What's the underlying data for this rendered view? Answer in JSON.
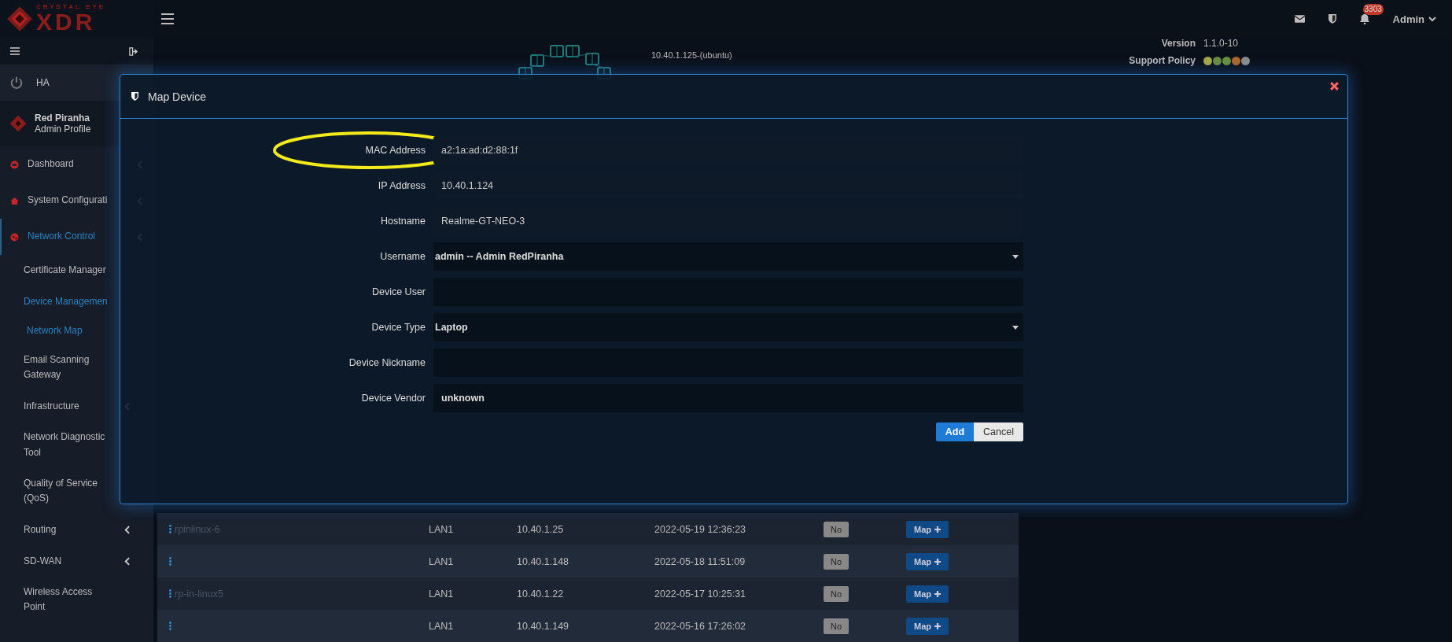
{
  "sidebar": {
    "brand_top": "CRYSTAL EYE",
    "brand": "XDR",
    "ha_label": "HA",
    "profile": {
      "name": "Red Piranha",
      "role": "Admin Profile"
    },
    "items": [
      {
        "label": "Dashboard",
        "kind": "section",
        "selected": false,
        "expandable": true
      },
      {
        "label": "System Configurati",
        "kind": "section",
        "selected": false,
        "expandable": true
      },
      {
        "label": "Network Control",
        "kind": "section",
        "selected": true,
        "expandable": true
      },
      {
        "label": "Certificate Manager",
        "kind": "link",
        "selected": false,
        "expandable": false
      },
      {
        "label": "Device Managemen",
        "kind": "link",
        "selected": true,
        "expandable": false
      },
      {
        "label": "Network Map",
        "kind": "sublink",
        "selected": true,
        "expandable": false
      },
      {
        "label": "Email Scanning Gateway",
        "kind": "link",
        "selected": false,
        "expandable": false
      },
      {
        "label": "Infrastructure",
        "kind": "link",
        "selected": false,
        "expandable": true
      },
      {
        "label": "Network Diagnostic Tool",
        "kind": "link",
        "selected": false,
        "expandable": false
      },
      {
        "label": "Quality of Service (QoS)",
        "kind": "link",
        "selected": false,
        "expandable": false
      },
      {
        "label": "Routing",
        "kind": "link",
        "selected": false,
        "expandable": true
      },
      {
        "label": "SD-WAN",
        "kind": "link",
        "selected": false,
        "expandable": true
      },
      {
        "label": "Wireless Access Point",
        "kind": "link",
        "selected": false,
        "expandable": false
      }
    ]
  },
  "topbar": {
    "notification_count": "3303",
    "user": "Admin"
  },
  "network_map": {
    "labels": [
      "10.40.1.125-(ubuntu)"
    ]
  },
  "info": {
    "version_label": "Version",
    "version": "1.1.0-10",
    "support_label": "Support Policy",
    "support_dots": [
      {
        "color": "#a9a845"
      },
      {
        "color": "#6b8e3f"
      },
      {
        "color": "#6b8e3f"
      },
      {
        "color": "#b0662a"
      },
      {
        "color": "#8c8c8c"
      }
    ]
  },
  "table": {
    "rows": [
      {
        "name": "rpinlinux-6",
        "interface": "LAN1",
        "ip": "10.40.1.25",
        "last_seen": "2022-05-19 12:36:23",
        "mapped": "No",
        "action": "Map"
      },
      {
        "interface": "LAN1",
        "ip": "10.40.1.148",
        "last_seen": "2022-05-18 11:51:09",
        "mapped": "No",
        "action": "Map"
      },
      {
        "name": "rp-in-linux5",
        "interface": "LAN1",
        "ip": "10.40.1.22",
        "last_seen": "2022-05-17 10:25:31",
        "mapped": "No",
        "action": "Map"
      },
      {
        "interface": "LAN1",
        "ip": "10.40.1.149",
        "last_seen": "2022-05-16 17:26:02",
        "mapped": "No",
        "action": "Map"
      }
    ]
  },
  "modal": {
    "title": "Map Device",
    "fields": [
      {
        "label": "MAC Address",
        "kind": "readonly",
        "value": "a2:1a:ad:d2:88:1f",
        "highlighted": true
      },
      {
        "label": "IP Address",
        "kind": "readonly",
        "value": "10.40.1.124",
        "highlighted": false
      },
      {
        "label": "Hostname",
        "kind": "readonly",
        "value": "Realme-GT-NEO-3",
        "highlighted": false
      },
      {
        "label": "Username",
        "kind": "select",
        "value": "admin -- Admin RedPiranha",
        "highlighted": false
      },
      {
        "label": "Device User",
        "kind": "input",
        "highlighted": false
      },
      {
        "label": "Device Type",
        "kind": "select",
        "value": "Laptop",
        "highlighted": false
      },
      {
        "label": "Device Nickname",
        "kind": "input",
        "highlighted": false
      },
      {
        "label": "Device Vendor",
        "kind": "input",
        "value": "unknown",
        "highlighted": false
      }
    ],
    "buttons": [
      {
        "label": "Add",
        "kind": "primary"
      },
      {
        "label": "Cancel",
        "kind": "secondary"
      }
    ]
  }
}
